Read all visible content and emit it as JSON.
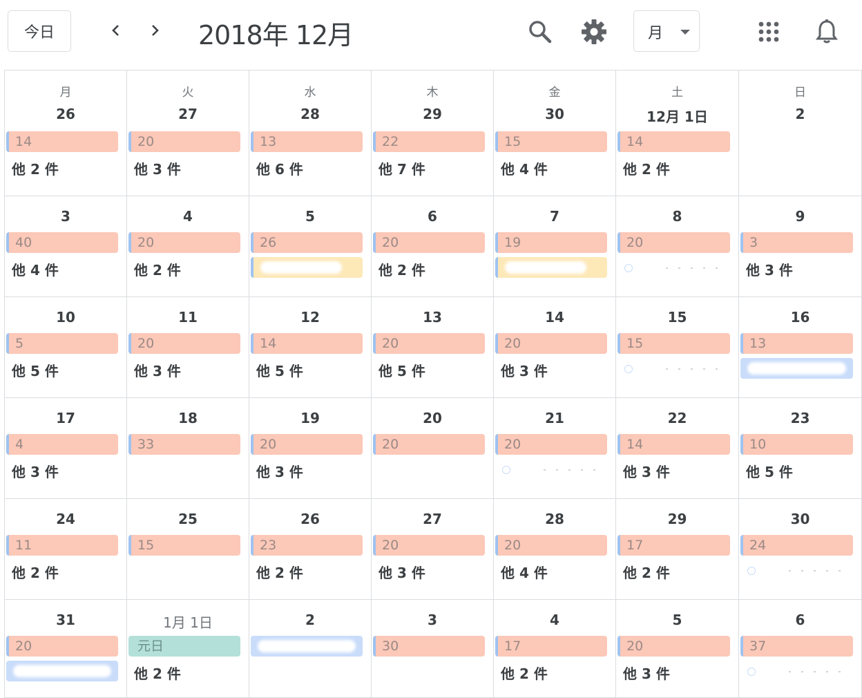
{
  "header": {
    "today_label": "今日",
    "title": "2018年 12月",
    "view_label": "月"
  },
  "weekdays": [
    "月",
    "火",
    "水",
    "木",
    "金",
    "土",
    "日"
  ],
  "weeks": [
    [
      {
        "date": "26",
        "events": [
          {
            "kind": "pink",
            "text": "14"
          }
        ],
        "more": "他 2 件"
      },
      {
        "date": "27",
        "events": [
          {
            "kind": "pink",
            "text": "20"
          }
        ],
        "more": "他 3 件"
      },
      {
        "date": "28",
        "events": [
          {
            "kind": "pink",
            "text": "13"
          }
        ],
        "more": "他 6 件"
      },
      {
        "date": "29",
        "events": [
          {
            "kind": "pink",
            "text": "22"
          }
        ],
        "more": "他 7 件"
      },
      {
        "date": "30",
        "events": [
          {
            "kind": "pink",
            "text": "15"
          }
        ],
        "more": "他 4 件"
      },
      {
        "date": "12月 1日",
        "events": [
          {
            "kind": "pink",
            "text": "14"
          }
        ],
        "more": "他 2 件"
      },
      {
        "date": "2",
        "events": [],
        "more": ""
      }
    ],
    [
      {
        "date": "3",
        "events": [
          {
            "kind": "pink",
            "text": "40"
          }
        ],
        "more": "他 4 件"
      },
      {
        "date": "4",
        "events": [
          {
            "kind": "pink",
            "text": "20"
          }
        ],
        "more": "他 2 件"
      },
      {
        "date": "5",
        "events": [
          {
            "kind": "pink",
            "text": "26"
          },
          {
            "kind": "yellow",
            "text": ""
          }
        ],
        "more": ""
      },
      {
        "date": "6",
        "events": [
          {
            "kind": "pink",
            "text": "20"
          }
        ],
        "more": "他 2 件"
      },
      {
        "date": "7",
        "events": [
          {
            "kind": "pink",
            "text": "19"
          },
          {
            "kind": "yellow",
            "text": ""
          }
        ],
        "more": ""
      },
      {
        "date": "8",
        "events": [
          {
            "kind": "pink",
            "text": "20"
          },
          {
            "kind": "faint",
            "text": ""
          }
        ],
        "more": ""
      },
      {
        "date": "9",
        "events": [
          {
            "kind": "pink",
            "text": "3"
          }
        ],
        "more": "他 3 件"
      }
    ],
    [
      {
        "date": "10",
        "events": [
          {
            "kind": "pink",
            "text": "5"
          }
        ],
        "more": "他 5 件"
      },
      {
        "date": "11",
        "events": [
          {
            "kind": "pink",
            "text": "20"
          }
        ],
        "more": "他 3 件"
      },
      {
        "date": "12",
        "events": [
          {
            "kind": "pink",
            "text": "14"
          }
        ],
        "more": "他 5 件"
      },
      {
        "date": "13",
        "events": [
          {
            "kind": "pink",
            "text": "20"
          }
        ],
        "more": "他 5 件"
      },
      {
        "date": "14",
        "events": [
          {
            "kind": "pink",
            "text": "20"
          }
        ],
        "more": "他 3 件"
      },
      {
        "date": "15",
        "events": [
          {
            "kind": "pink",
            "text": "15"
          },
          {
            "kind": "faint",
            "text": ""
          }
        ],
        "more": ""
      },
      {
        "date": "16",
        "events": [
          {
            "kind": "pink",
            "text": "13"
          },
          {
            "kind": "blurblue",
            "text": ""
          }
        ],
        "more": ""
      }
    ],
    [
      {
        "date": "17",
        "events": [
          {
            "kind": "pink",
            "text": "4"
          }
        ],
        "more": "他 3 件"
      },
      {
        "date": "18",
        "events": [
          {
            "kind": "pink",
            "text": "33"
          }
        ],
        "more": ""
      },
      {
        "date": "19",
        "events": [
          {
            "kind": "pink",
            "text": "20"
          }
        ],
        "more": "他 3 件"
      },
      {
        "date": "20",
        "events": [
          {
            "kind": "pink",
            "text": "20"
          }
        ],
        "more": ""
      },
      {
        "date": "21",
        "events": [
          {
            "kind": "pink",
            "text": "20"
          },
          {
            "kind": "faint",
            "text": ""
          }
        ],
        "more": ""
      },
      {
        "date": "22",
        "events": [
          {
            "kind": "pink",
            "text": "14"
          }
        ],
        "more": "他 3 件"
      },
      {
        "date": "23",
        "events": [
          {
            "kind": "pink",
            "text": "10"
          }
        ],
        "more": "他 5 件"
      }
    ],
    [
      {
        "date": "24",
        "events": [
          {
            "kind": "pink",
            "text": "11"
          }
        ],
        "more": "他 2 件"
      },
      {
        "date": "25",
        "events": [
          {
            "kind": "pink",
            "text": "15"
          }
        ],
        "more": ""
      },
      {
        "date": "26",
        "events": [
          {
            "kind": "pink",
            "text": "23"
          }
        ],
        "more": "他 2 件"
      },
      {
        "date": "27",
        "events": [
          {
            "kind": "pink",
            "text": "20"
          }
        ],
        "more": "他 3 件"
      },
      {
        "date": "28",
        "events": [
          {
            "kind": "pink",
            "text": "20"
          }
        ],
        "more": "他 4 件"
      },
      {
        "date": "29",
        "events": [
          {
            "kind": "pink",
            "text": "17"
          }
        ],
        "more": "他 2 件"
      },
      {
        "date": "30",
        "events": [
          {
            "kind": "pink",
            "text": "24"
          },
          {
            "kind": "faint",
            "text": ""
          }
        ],
        "more": ""
      }
    ],
    [
      {
        "date": "31",
        "events": [
          {
            "kind": "pink",
            "text": "20"
          },
          {
            "kind": "blurblue",
            "text": ""
          }
        ],
        "more": ""
      },
      {
        "date": "1月 1日",
        "outside": true,
        "events": [
          {
            "kind": "green",
            "text": "元日"
          }
        ],
        "more": "他 2 件"
      },
      {
        "date": "2",
        "events": [
          {
            "kind": "blurblue",
            "text": ""
          }
        ],
        "more": ""
      },
      {
        "date": "3",
        "events": [
          {
            "kind": "pink",
            "text": "30"
          }
        ],
        "more": ""
      },
      {
        "date": "4",
        "events": [
          {
            "kind": "pink",
            "text": "17"
          }
        ],
        "more": "他 2 件"
      },
      {
        "date": "5",
        "events": [
          {
            "kind": "pink",
            "text": "20"
          }
        ],
        "more": "他 3 件"
      },
      {
        "date": "6",
        "events": [
          {
            "kind": "pink",
            "text": "37"
          },
          {
            "kind": "faint",
            "text": ""
          }
        ],
        "more": ""
      }
    ]
  ],
  "colors": {
    "event_pink": "#fcc8b8",
    "event_green": "#b4e0da",
    "event_blue": "#c9dcfa",
    "event_yellow": "#fde8b8",
    "grid_line": "#dadce0"
  },
  "icons": [
    "chevron-left-icon",
    "chevron-right-icon",
    "search-icon",
    "gear-icon",
    "caret-down-icon",
    "apps-grid-icon",
    "bell-icon"
  ]
}
